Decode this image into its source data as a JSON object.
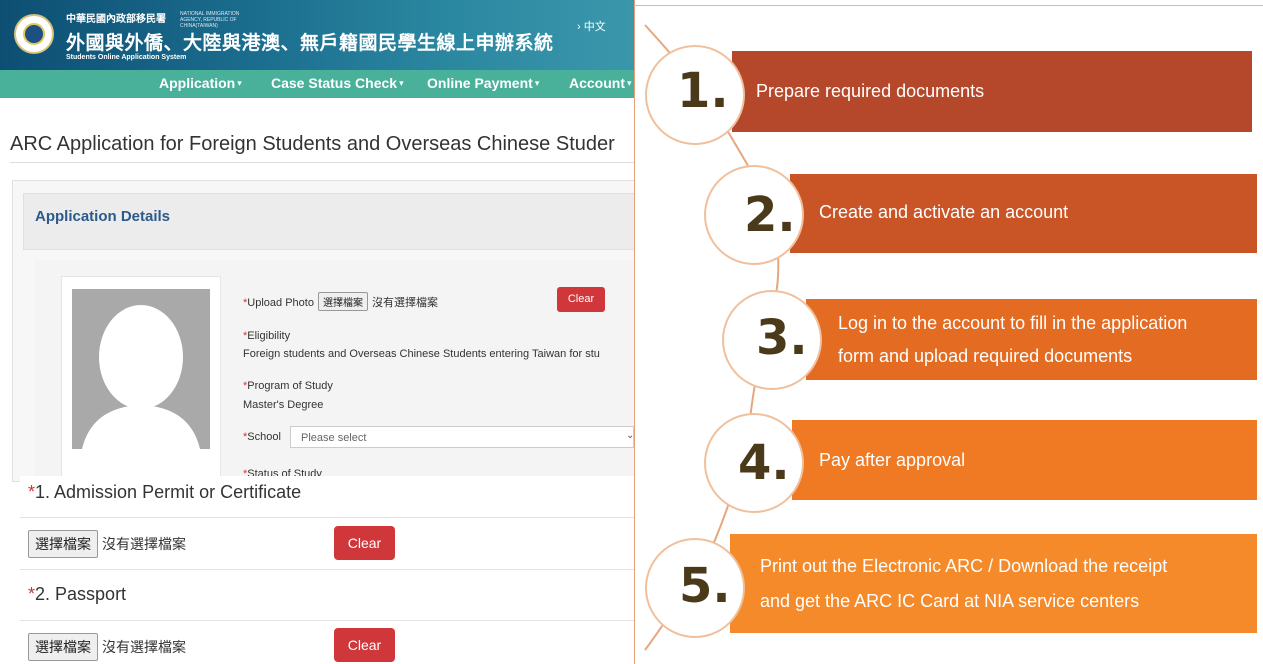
{
  "header": {
    "agency": "中華民國內政部移民署",
    "agency_en": "NATIONAL IMMIGRATION AGENCY, REPUBLIC OF CHINA(TAIWAN)",
    "system_title": "外國與外僑、大陸與港澳、無戶籍國民學生線上申辦系統",
    "system_title_en": "Students Online Application System",
    "language": "› 中文"
  },
  "nav": {
    "items": [
      {
        "label": "Application"
      },
      {
        "label": "Case Status Check"
      },
      {
        "label": "Online Payment"
      },
      {
        "label": "Account"
      }
    ],
    "caret": "▾"
  },
  "page_title": "ARC Application for Foreign Students and Overseas Chinese Studer",
  "panel": {
    "heading": "Application Details"
  },
  "form": {
    "required_mark": "*",
    "upload_photo_label": "Upload Photo",
    "choose_file": "選擇檔案",
    "no_file": "沒有選擇檔案",
    "clear": "Clear",
    "eligibility_label": "Eligibility",
    "eligibility_value": "Foreign students and Overseas Chinese Students entering Taiwan for stu",
    "program_label": "Program of Study",
    "program_value": "Master's Degree",
    "school_label": "School",
    "school_placeholder": "Please select",
    "status_label": "Status of Study"
  },
  "uploads": [
    {
      "label": "1. Admission Permit or Certificate",
      "choose": "選擇檔案",
      "no_file": "沒有選擇檔案",
      "clear": "Clear"
    },
    {
      "label": "2. Passport",
      "choose": "選擇檔案",
      "no_file": "沒有選擇檔案",
      "clear": "Clear"
    }
  ],
  "steps": [
    {
      "num": "1.",
      "lines": [
        "Prepare required documents"
      ],
      "color": "#b5482a"
    },
    {
      "num": "2.",
      "lines": [
        "Create and activate an account"
      ],
      "color": "#c95526"
    },
    {
      "num": "3.",
      "lines": [
        "Log in to the account to fill in the application",
        "form and upload required documents"
      ],
      "color": "#e46b22"
    },
    {
      "num": "4.",
      "lines": [
        "Pay after approval"
      ],
      "color": "#f07a23"
    },
    {
      "num": "5.",
      "lines": [
        "Print out the Electronic ARC / Download the receipt",
        "and get the ARC IC Card at NIA service centers"
      ],
      "color": "#f58a2a"
    }
  ],
  "colors": {
    "banner": "#1b6d8e",
    "nav": "#49b09a",
    "clear_button": "#d0373a",
    "panel_heading": "#2c5a8a"
  }
}
